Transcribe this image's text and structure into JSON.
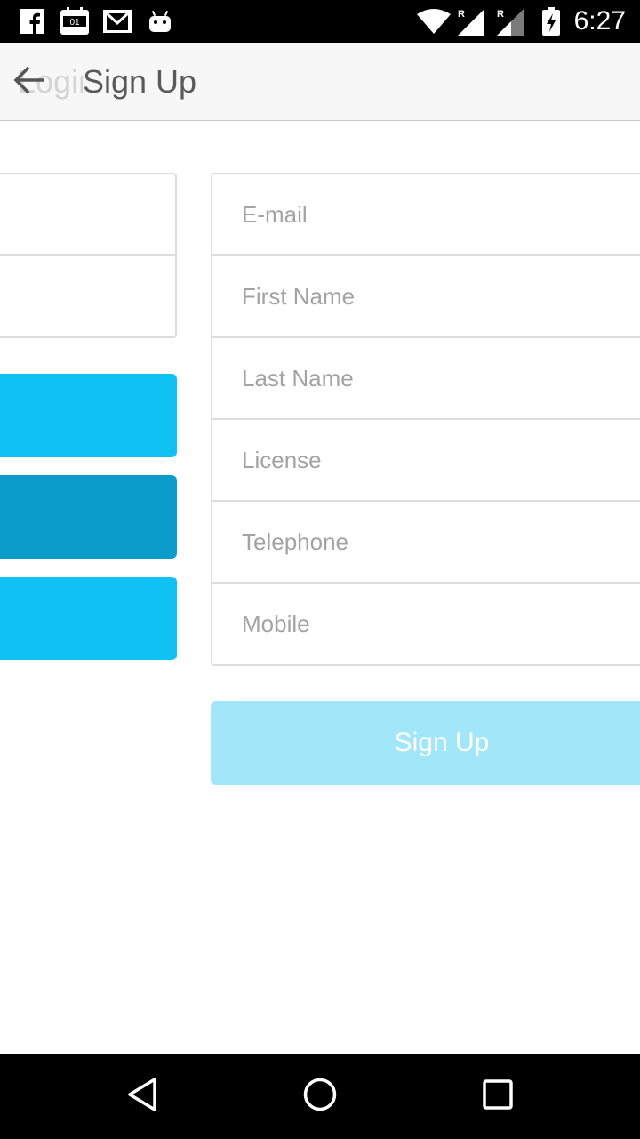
{
  "status_bar": {
    "time": "6:27",
    "icons": [
      "facebook-icon",
      "calendar-icon",
      "gmail-icon",
      "android-icon",
      "wifi-icon",
      "signal-roaming-icon",
      "signal-roaming-icon",
      "battery-charging-icon"
    ]
  },
  "toolbar": {
    "previous_title": "Login",
    "title": "Sign Up",
    "back_icon": "arrow-back-icon"
  },
  "form": {
    "fields": [
      {
        "name": "email",
        "placeholder": "E-mail",
        "value": ""
      },
      {
        "name": "first-name",
        "placeholder": "First Name",
        "value": ""
      },
      {
        "name": "last-name",
        "placeholder": "Last Name",
        "value": ""
      },
      {
        "name": "license",
        "placeholder": "License",
        "value": ""
      },
      {
        "name": "telephone",
        "placeholder": "Telephone",
        "value": ""
      },
      {
        "name": "mobile",
        "placeholder": "Mobile",
        "value": ""
      }
    ],
    "submit_label": "Sign Up"
  },
  "left_panel": {
    "button_colors": [
      "#10c2f3",
      "#0b9ccc",
      "#10c2f3"
    ]
  },
  "colors": {
    "accent": "#10c2f3",
    "accent_dark": "#0b9ccc",
    "accent_disabled": "#a1e6f9"
  },
  "nav_bar": {
    "icons": [
      "back-triangle-icon",
      "home-circle-icon",
      "recents-square-icon"
    ]
  }
}
